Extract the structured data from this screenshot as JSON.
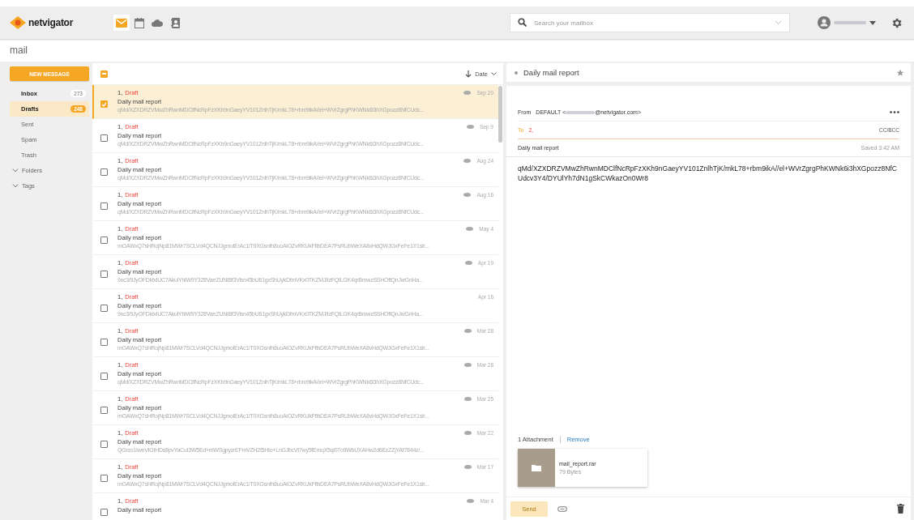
{
  "app": {
    "logo": "netvigator",
    "section_title": "mail"
  },
  "app_switcher": [
    {
      "kind": "mail",
      "selected": true
    },
    {
      "kind": "calendar",
      "selected": false
    },
    {
      "kind": "cloud",
      "selected": false
    },
    {
      "kind": "contacts",
      "selected": false
    }
  ],
  "search": {
    "placeholder": "Search your mailbox"
  },
  "sidebar": {
    "new_message": "NEW MESSAGE",
    "items": [
      {
        "label": "Inbox",
        "count": "273",
        "selected": false
      },
      {
        "label": "Drafts",
        "count": "248",
        "selected": true
      },
      {
        "label": "Sent",
        "selected": false
      },
      {
        "label": "Spam",
        "selected": false
      },
      {
        "label": "Trash",
        "selected": false
      }
    ],
    "groups": [
      {
        "label": "Folders",
        "expanded": false
      },
      {
        "label": "Tags",
        "expanded": false
      }
    ]
  },
  "message_list": {
    "sort": "Date",
    "select_all": {
      "indeterminate": true
    },
    "rows": [
      {
        "count": "1,",
        "status": "Draft",
        "subject": "Daily mail report",
        "preview": "qMd/XZXDRZVMwZhRwnMDClfNcRpFzXKh9nGaeyYV101ZnlhTjK/mkL78+rbm9ikA//el+WVrZgrgPhKWNk6i3hXGpozz8NfCUdc...",
        "date": "Sep 20",
        "seen": true,
        "selected": true,
        "checked": true
      },
      {
        "count": "1,",
        "status": "Draft",
        "subject": "Daily mail report",
        "preview": "qMd/XZXDRZVMwZhRwnMDClfNcRpFzXKh9nGaeyYV101ZnlhTjK/mkL78+rbm9ikA//el+WVrZgrgPhKWNk6i3hXGpozz8NfCUdc...",
        "date": "Sep 9",
        "seen": true,
        "selected": false,
        "checked": false
      },
      {
        "count": "1,",
        "status": "Draft",
        "subject": "Daily mail report",
        "preview": "qMd/XZXDRZVMwZhRwnMDClfNcRpFzXKh9nGaeyYV101ZnlhTjK/mkL78+rbm9ikA//el+WVrZgrgPhKWNk6i3hXGpozz8NfCUdc...",
        "date": "Aug 24",
        "seen": true,
        "selected": false,
        "checked": false
      },
      {
        "count": "1,",
        "status": "Draft",
        "subject": "Daily mail report",
        "preview": "qMd/XZXDRZVMwZhRwnMDClfNcRpFzXKh9nGaeyYV101ZnlhTjK/mkL78+rbm9ikA//el+WVrZgrgPhKWNk6i3hXGpozz8NfCUdc...",
        "date": "Aug 16",
        "seen": true,
        "selected": false,
        "checked": false
      },
      {
        "count": "1,",
        "status": "Draft",
        "subject": "Daily mail report",
        "preview": "mOAWxQ7sHRojNp81MWr7SCLVd4QCNJJgmolErAc1/T0XGsnfh8uoAiOZvRKUkFflhDEA7PsRUbWeXA8vHdQWJGxFeFe1X1slr...",
        "date": "May 4",
        "seen": true,
        "selected": false,
        "checked": false
      },
      {
        "count": "1,",
        "status": "Draft",
        "subject": "Daily mail report",
        "preview": "9xc3/9JyOFDktxlUC7AkulYhiW9Y328VarrZUNiBf3Vlsn45bU61gxShUykDfmVKx0TKZMJ/IzFQILGK4qrBmwzSSHOftQnJwGnHa...",
        "date": "Apr 19",
        "seen": true,
        "selected": false,
        "checked": false
      },
      {
        "count": "1,",
        "status": "Draft",
        "subject": "Daily mail report",
        "preview": "9xc3/9JyOFDktxlUC7AkulYhiW9Y328VarrZUNiBf3Vlsn45bU61gxShUykDfmVKx0TKZMJ/IzFQILGK4qrBmwzSSHOftQnJwGnHa...",
        "date": "Apr 16",
        "seen": false,
        "selected": false,
        "checked": false
      },
      {
        "count": "1,",
        "status": "Draft",
        "subject": "Daily mail report",
        "preview": "mOAWxQ7sHRojNp81MWr7SCLVd4QCNJJgmolErAc1/T0XGsnfh8uoAiOZvRKUkFflhDEA7PsRUbWeXA8vHdQWJGxFeFe1X1slr...",
        "date": "Mar 28",
        "seen": true,
        "selected": false,
        "checked": false
      },
      {
        "count": "1,",
        "status": "Draft",
        "subject": "Daily mail report",
        "preview": "qMd/XZXDRZVMwZhRwnMDClfNcRpFzXKh9nGaeyYV101ZnlhTjK/mkL78+rbm9ikA//el+WVrZgrgPhKWNk6i3hXGpozz8NfCUdc...",
        "date": "Mar 28",
        "seen": true,
        "selected": false,
        "checked": false
      },
      {
        "count": "1,",
        "status": "Draft",
        "subject": "Daily mail report",
        "preview": "mOAWxQ7sHRojNp81MWr7SCLVd4QCNJJgmolErAc1/T0XGsnfh8uoAiOZvRKUkFflhDEA7PsRUbWeXA8vHdQWJGxFeFe1X1slr...",
        "date": "Mar 25",
        "seen": true,
        "selected": false,
        "checked": false
      },
      {
        "count": "1,",
        "status": "Draft",
        "subject": "Daily mail report",
        "preview": "QGrzo1IweVtGtHDs8pvYaCuI3W5Ed+mWSgpyzrEFmVZH2I5HIo+LnGJbcVt7wy5fEmqX5qi07o9WbUXAHw2d6EzZZjYAf7844z/...",
        "date": "Mar 22",
        "seen": true,
        "selected": false,
        "checked": false
      },
      {
        "count": "1,",
        "status": "Draft",
        "subject": "Daily mail report",
        "preview": "mOAWxQ7sHRojNp81MWr7SCLVd4QCNJJgmolErAc1/T0XGsnfh8uoAiOZvRKUkFflhDEA7PsRUbWeXA8vHdQWJGxFeFe1X1slr...",
        "date": "Mar 17",
        "seen": true,
        "selected": false,
        "checked": false
      },
      {
        "count": "1,",
        "status": "Draft",
        "subject": "Daily mail report",
        "date": "Mar 4",
        "seen": true,
        "selected": false,
        "checked": false
      }
    ]
  },
  "reader": {
    "title": "Daily mail report",
    "starred": false,
    "from_label": "From",
    "from_name": "DEFAULT <",
    "from_domain": "@netvigator.com>",
    "to_label": "To",
    "to_value": "2,",
    "cc_bcc": "CC/BCC",
    "subject": "Daily mail report",
    "saved": "Saved 3:42 AM",
    "body": "qMd/XZXDRZVMwZhRwnMDClfNcRpFzXKh9nGaeyYV101ZnlhTjK/mkL78+rbm9ikA//el+WVrZgrgPhKWNk6i3hXGpozz8NfCUdcv3Y4/DYUlYh7dN1gSkCWkazOn0Wr8",
    "attachment_count": "1 Attachment",
    "remove": "Remove",
    "attachments": [
      {
        "name": "mail_report.rar",
        "size": "79 Bytes"
      }
    ],
    "send": "Send",
    "send_disabled": true
  }
}
